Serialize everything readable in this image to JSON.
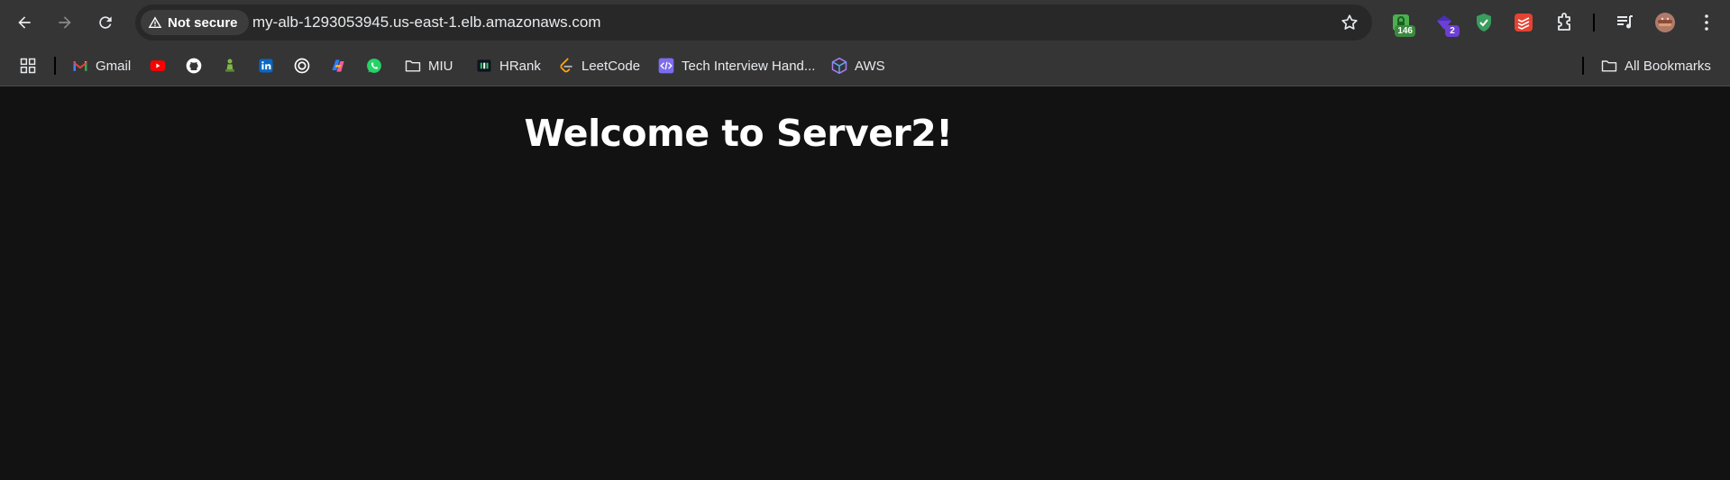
{
  "toolbar": {
    "security_chip_label": "Not secure",
    "url": "my-alb-1293053945.us-east-1.elb.amazonaws.com",
    "extensions": [
      {
        "name": "password-manager",
        "badge": "146",
        "badge_color": "#3b8a3e"
      },
      {
        "name": "extension-2",
        "badge": "2",
        "badge_color": "#6c3fd6"
      }
    ]
  },
  "bookmarks": {
    "items": [
      {
        "label": "Gmail"
      },
      {
        "label": "MIU"
      },
      {
        "label": "HRank"
      },
      {
        "label": "LeetCode"
      },
      {
        "label": "Tech Interview Hand..."
      },
      {
        "label": "AWS"
      }
    ],
    "all_bookmarks_label": "All Bookmarks"
  },
  "page": {
    "heading": "Welcome to Server2!"
  },
  "colors": {
    "toolbar_bg": "#353535",
    "omnibox_bg": "#282828",
    "page_bg": "#121212",
    "heading": "#ffffff"
  }
}
